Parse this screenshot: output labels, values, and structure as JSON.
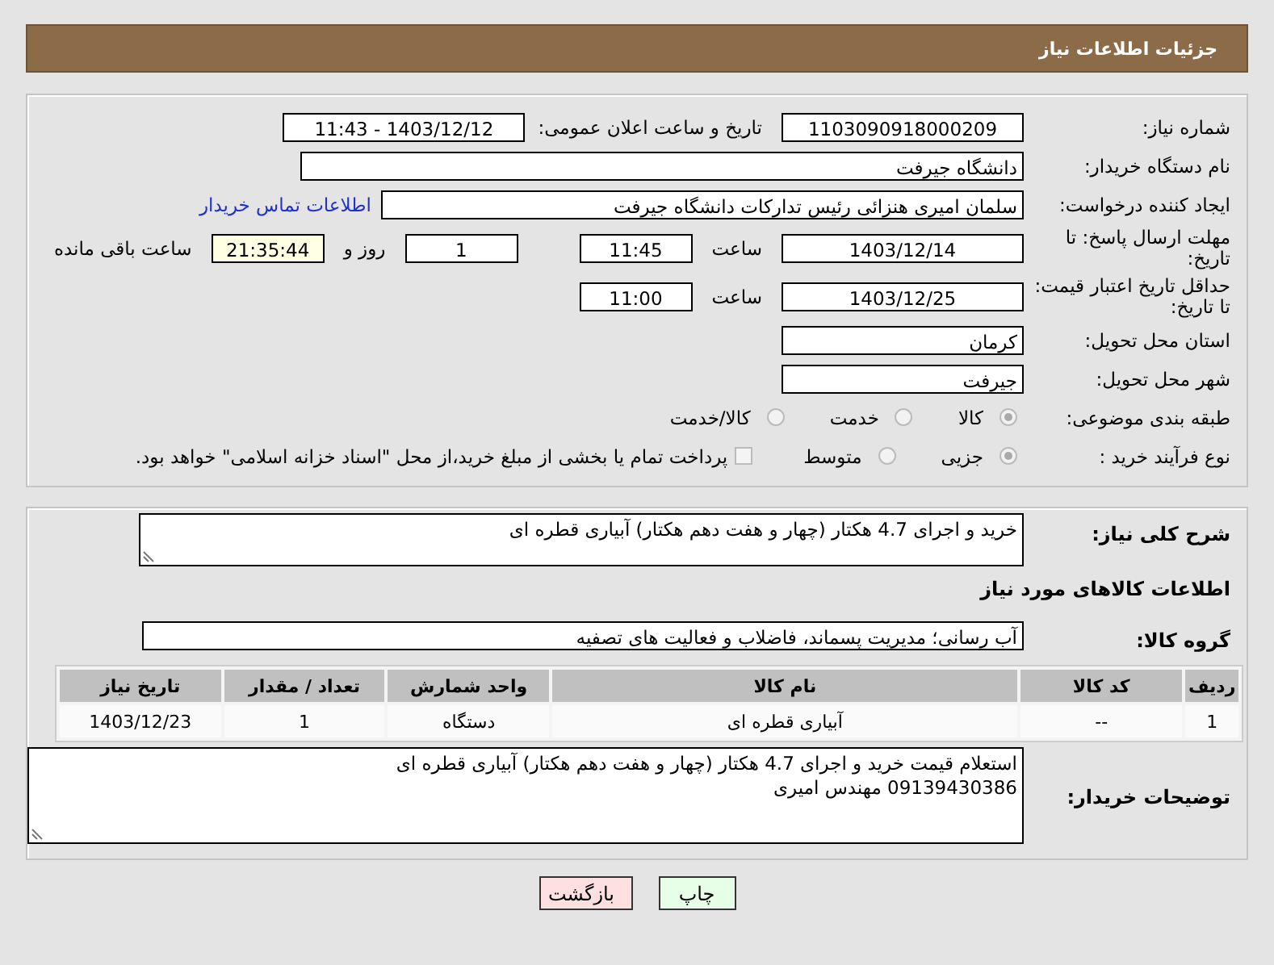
{
  "header": {
    "title": "جزئیات اطلاعات نیاز"
  },
  "need_number": {
    "label": "شماره نیاز:",
    "value": "1103090918000209"
  },
  "announce": {
    "label": "تاریخ و ساعت اعلان عمومی:",
    "value": "1403/12/12 - 11:43"
  },
  "buyer_org": {
    "label": "نام دستگاه خریدار:",
    "value": "دانشگاه جیرفت"
  },
  "requester": {
    "label": "ایجاد کننده درخواست:",
    "value": "سلمان امیری هنزائی رئیس تدارکات دانشگاه جیرفت",
    "link": "اطلاعات تماس خریدار"
  },
  "response_deadline": {
    "label": "مهلت ارسال پاسخ: تا تاریخ:",
    "date": "1403/12/14",
    "time_label": "ساعت",
    "time": "11:45",
    "days": "1",
    "days_label": "روز و",
    "remaining": "21:35:44",
    "remaining_label": "ساعت باقی مانده"
  },
  "price_validity": {
    "label": "حداقل تاریخ اعتبار قیمت: تا تاریخ:",
    "date": "1403/12/25",
    "time_label": "ساعت",
    "time": "11:00"
  },
  "province": {
    "label": "استان محل تحویل:",
    "value": "کرمان"
  },
  "city": {
    "label": "شهر محل تحویل:",
    "value": "جیرفت"
  },
  "category": {
    "label": "طبقه بندی موضوعی:",
    "options": [
      {
        "label": "کالا",
        "selected": true
      },
      {
        "label": "خدمت",
        "selected": false
      },
      {
        "label": "کالا/خدمت",
        "selected": false
      }
    ]
  },
  "process": {
    "label": "نوع فرآیند خرید :",
    "options": [
      {
        "label": "جزیی",
        "selected": true
      },
      {
        "label": "متوسط",
        "selected": false
      }
    ],
    "payment": {
      "label": "پرداخت تمام یا بخشی از مبلغ خرید،از محل \"اسناد خزانه اسلامی\" خواهد بود.",
      "checked": false
    }
  },
  "description": {
    "label": "شرح کلی نیاز:",
    "value": "خرید و اجرای 4.7 هکتار (چهار و هفت دهم هکتار) آبیاری قطره ای"
  },
  "goods_heading": "اطلاعات کالاهای مورد نیاز",
  "goods_group": {
    "label": "گروه کالا:",
    "value": "آب رسانی؛ مدیریت پسماند، فاضلاب و فعالیت های تصفیه"
  },
  "table": {
    "columns": [
      "ردیف",
      "کد کالا",
      "نام کالا",
      "واحد شمارش",
      "تعداد / مقدار",
      "تاریخ نیاز"
    ],
    "rows": [
      [
        "1",
        "--",
        "آبیاری قطره ای",
        "دستگاه",
        "1",
        "1403/12/23"
      ]
    ]
  },
  "buyer_notes": {
    "label": "توضیحات خریدار:",
    "lines": [
      "استعلام قیمت خرید و اجرای 4.7 هکتار (چهار و هفت دهم هکتار) آبیاری قطره ای",
      "09139430386 مهندس امیری"
    ]
  },
  "buttons": [
    {
      "label": "چاپ",
      "kind": "print"
    },
    {
      "label": "بازگشت",
      "kind": "back"
    }
  ]
}
